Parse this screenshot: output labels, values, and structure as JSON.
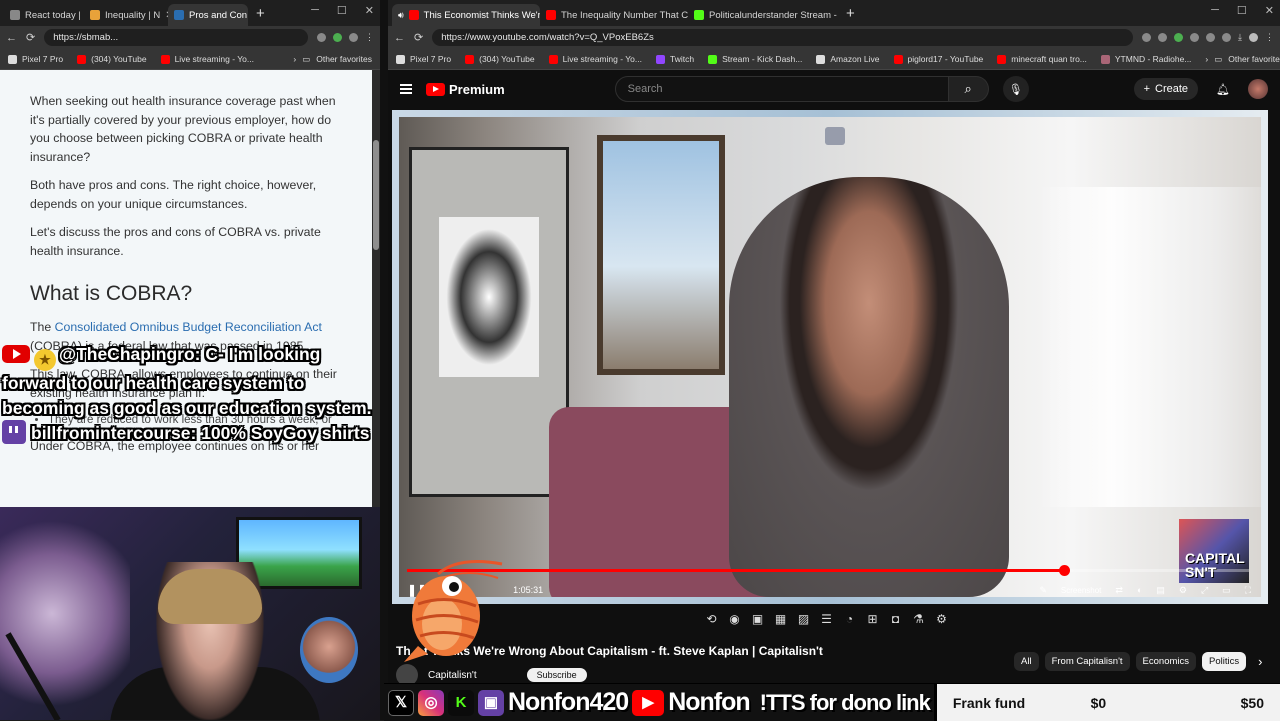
{
  "left_window": {
    "tabs": [
      {
        "label": "React today |",
        "color": "#888888"
      },
      {
        "label": "Inequality | N",
        "color": "#e8a23a"
      },
      {
        "label": "Pros and Con",
        "color": "#2a6db0",
        "active": true
      }
    ],
    "url": "https://sbmab...",
    "bookmarks": [
      "Pixel 7 Pro",
      "(304) YouTube",
      "Live streaming - Yo..."
    ],
    "other_favorites": "Other favorites",
    "article": {
      "p1": "When seeking out health insurance coverage past when it's partially covered by your previous employer, how do you choose between picking COBRA or private health insurance?",
      "p2": "Both have pros and cons. The right choice, however, depends on your unique circumstances.",
      "p3": "Let's discuss the pros and cons of COBRA vs. private health insurance.",
      "heading": "What is COBRA?",
      "p4_prefix": "The ",
      "p4_link": "Consolidated Omnibus Budget Reconciliation Act",
      "p4_rest": " (COBRA) is a federal law that was passed in 1985.",
      "p5": "This law, COBRA, allows employees to continue on their existing health insurance plan if:",
      "bullet1": "They are reduced to work less than 30 hours a week, or",
      "p6": "Under COBRA, the employee continues on his or her"
    }
  },
  "chat": [
    {
      "platform": "youtube",
      "user": "@TheChapingro",
      "message": "C- I'm looking forward to our health care system to becoming as good as our education system."
    },
    {
      "platform": "twitch",
      "user": "billfromintercourse",
      "message": "100% SoyGoy shirts"
    }
  ],
  "right_window": {
    "tabs": [
      {
        "label": "This Economist Thinks We're",
        "color": "#ff0000",
        "active": true
      },
      {
        "label": "The Inequality Number That Chan",
        "color": "#ff0000"
      },
      {
        "label": "Politicalunderstander Stream - Wa",
        "color": "#53fc18"
      }
    ],
    "url": "https://www.youtube.com/watch?v=Q_VPoxEB6Zs",
    "bookmarks": [
      "Pixel 7 Pro",
      "(304) YouTube",
      "Live streaming - Yo...",
      "Twitch",
      "Stream - Kick Dash...",
      "Amazon Live",
      "piglord17 - YouTube",
      "minecraft quan tro...",
      "YTMND - Radiohe..."
    ],
    "other_favorites": "Other favorites"
  },
  "youtube": {
    "logo": "Premium",
    "search_placeholder": "Search",
    "create_label": "Create",
    "time": "1:05:31",
    "progress": 0.78,
    "screenshot_label": "Screenshot",
    "corner_logo": "CAPITAL SN'T",
    "title": "Th... t Thinks We're Wrong About Capitalism - ft. Steve Kaplan | Capitalisn't",
    "channel": "Capitalisn't",
    "subscribe_label": "Subscribe",
    "chips": [
      "All",
      "From Capitalisn't",
      "Economics",
      "Politics"
    ]
  },
  "bottom_bar": {
    "handle1": "Nonfon420",
    "handle2": "Nonfon",
    "tts": "!TTS for dono link",
    "fund_label": "Frank fund",
    "fund_current": "$0",
    "fund_goal": "$50"
  },
  "colors": {
    "youtube_red": "#ff0000",
    "twitch_purple": "#6441a5",
    "kick_green": "#53fc18",
    "link_blue": "#2a6db0"
  }
}
